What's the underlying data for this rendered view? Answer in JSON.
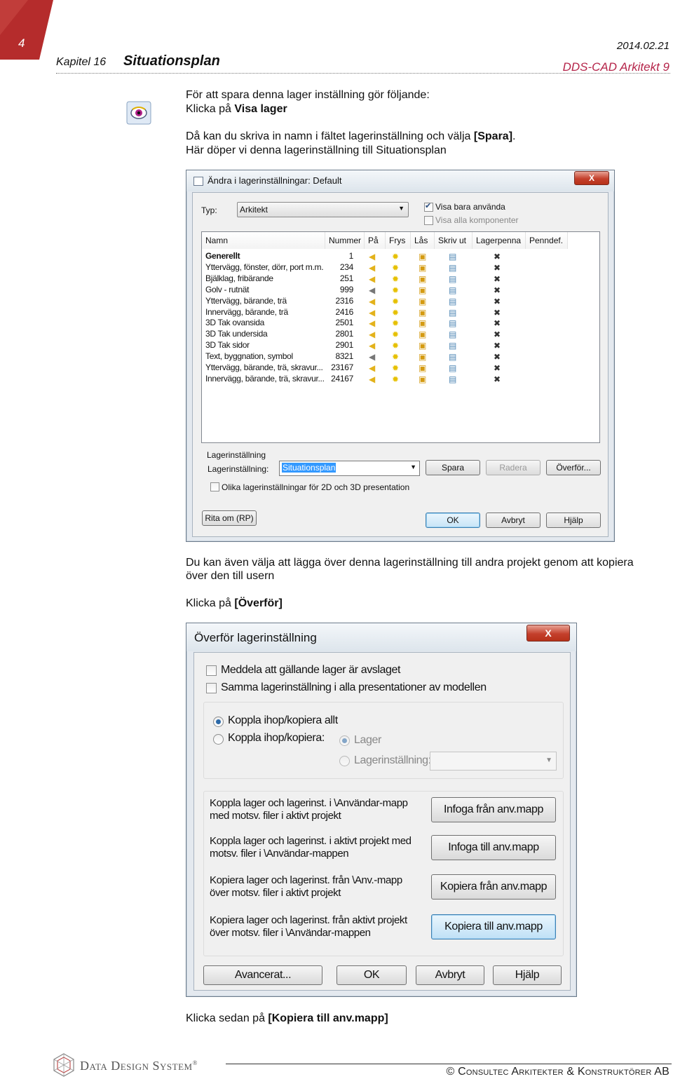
{
  "header": {
    "page_number": "4",
    "chapter": "Kapitel 16",
    "title": "Situationsplan",
    "date": "2014.02.21",
    "product": "DDS-CAD Arkitekt 9"
  },
  "intro": {
    "line1": "För att spara denna lager inställning gör följande:",
    "line2_prefix": "Klicka på ",
    "line2_bold": "Visa lager",
    "line3_prefix": "Då kan du skriva in namn i fältet lagerinställning och välja ",
    "line3_bold": "[Spara]",
    "line3_suffix": ".",
    "line4": "Här döper vi denna lagerinställning till Situationsplan"
  },
  "dialog1": {
    "title": "Ändra i lagerinställningar: Default",
    "close": "X",
    "typ_label": "Typ:",
    "typ_value": "Arkitekt",
    "visa_bara": "Visa bara använda",
    "visa_alla": "Visa alla komponenter",
    "columns": [
      "Namn",
      "Nummer",
      "På",
      "Frys",
      "Lås",
      "Skriv ut",
      "Lagerpenna",
      "Penndef."
    ],
    "rows": [
      {
        "name": "Generellt",
        "num": "1"
      },
      {
        "name": "Yttervägg, fönster, dörr, port m.m.",
        "num": "234"
      },
      {
        "name": "Bjälklag, fribärande",
        "num": "251"
      },
      {
        "name": "Golv - rutnät",
        "num": "999"
      },
      {
        "name": "Yttervägg, bärande, trä",
        "num": "2316"
      },
      {
        "name": "Innervägg, bärande, trä",
        "num": "2416"
      },
      {
        "name": "3D Tak ovansida",
        "num": "2501"
      },
      {
        "name": "3D Tak undersida",
        "num": "2801"
      },
      {
        "name": "3D Tak sidor",
        "num": "2901"
      },
      {
        "name": "Text, byggnation, symbol",
        "num": "8321"
      },
      {
        "name": "Yttervägg, bärande, trä, skravur...",
        "num": "23167"
      },
      {
        "name": "Innervägg, bärande, trä, skravur...",
        "num": "24167"
      }
    ],
    "group_label": "Lagerinställning",
    "setting_label": "Lagerinställning:",
    "setting_value": "Situationsplan",
    "spara": "Spara",
    "radera": "Radera",
    "overfor": "Överför...",
    "olika": "Olika lagerinställningar för 2D och 3D presentation",
    "rita_om": "Rita om (RP)",
    "ok": "OK",
    "avbryt": "Avbryt",
    "hjalp": "Hjälp"
  },
  "middle": {
    "line1": "Du kan även välja att lägga över denna lagerinställning till andra projekt genom att kopiera",
    "line2": "över den till usern",
    "line3_prefix": "Klicka på ",
    "line3_bold": "[Överför]"
  },
  "dialog2": {
    "title": "Överför lagerinställning",
    "close": "X",
    "cb1": "Meddela att gällande lager är avslaget",
    "cb2": "Samma lagerinställning i alla presentationer av modellen",
    "radio1": "Koppla ihop/kopiera allt",
    "radio2": "Koppla ihop/kopiera:",
    "sub1": "Lager",
    "sub2": "Lagerinställning:",
    "actions": [
      {
        "l1": "Koppla lager och lagerinst. i \\Användar-mapp",
        "l2": "med motsv. filer i aktivt projekt",
        "btn": "Infoga från anv.mapp"
      },
      {
        "l1": "Koppla lager och lagerinst. i aktivt projekt med",
        "l2": "motsv. filer i \\Användar-mappen",
        "btn": "Infoga till anv.mapp"
      },
      {
        "l1": "Kopiera lager och lagerinst. från \\Anv.-mapp",
        "l2": "över motsv. filer i aktivt projekt",
        "btn": "Kopiera från anv.mapp"
      },
      {
        "l1": "Kopiera lager och lagerinst. från aktivt projekt",
        "l2": "över motsv. filer i \\Användar-mappen",
        "btn": "Kopiera till anv.mapp"
      }
    ],
    "avancerat": "Avancerat...",
    "ok": "OK",
    "avbryt": "Avbryt",
    "hjalp": "Hjälp"
  },
  "final": {
    "prefix": "Klicka sedan på ",
    "bold": "[Kopiera till anv.mapp]"
  },
  "footer": {
    "brand": "Data Design System",
    "reg": "®",
    "copyright": "© Consultec Arkitekter & Konstruktörer AB"
  },
  "colors": {
    "accent": "#b5254a",
    "corner": "#b52c2c",
    "selection": "#3399ff"
  }
}
